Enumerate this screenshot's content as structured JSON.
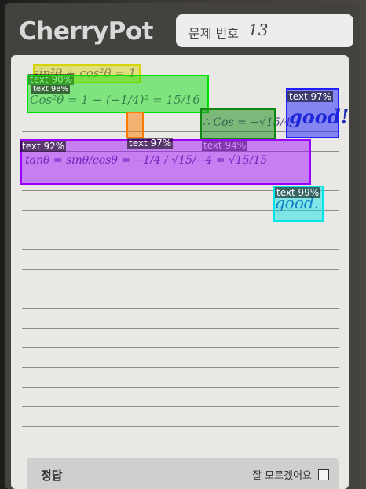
{
  "brand": "CherryPot",
  "question": {
    "label": "문제 번호",
    "number": "13"
  },
  "answer": {
    "label": "정답",
    "unsure": "잘 모르겠어요"
  },
  "handwriting": {
    "line1": "sin²θ + cos²θ = 1",
    "line2": "Cos²θ = 1 − (−1/4)² = 15/16",
    "line3_cos": "∴ Cos = −√15/4",
    "tan_line": "tanθ = sinθ/cosθ = −1/4 / √15/−4 = √15/15",
    "good1": "good!",
    "good2": "good."
  },
  "detections": [
    {
      "label": "text 90%",
      "color": "#d4d400"
    },
    {
      "label": "text 98%",
      "color": "#00e000"
    },
    {
      "label": "text 97%",
      "color": "#ff7a00"
    },
    {
      "label": "text 94%",
      "color": "#118811"
    },
    {
      "label": "text 97%",
      "color": "#2020ff"
    },
    {
      "label": "text 92%",
      "color": "#9b00ff"
    },
    {
      "label": "text 99%",
      "color": "#00e5e5"
    }
  ]
}
